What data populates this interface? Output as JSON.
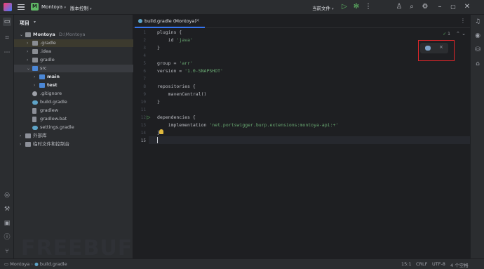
{
  "titlebar": {
    "project_badge": "M",
    "project_name": "Montoya",
    "vcs_label": "版本控制",
    "run_config": "当前文件"
  },
  "project_panel": {
    "title": "项目",
    "tree": [
      {
        "label": "Montoya",
        "path": "D:\\Montoya",
        "indent": 0,
        "expanded": true,
        "icon": "folder-icon"
      },
      {
        "label": ".gradle",
        "indent": 1,
        "expanded": false,
        "icon": "folder-icon"
      },
      {
        "label": ".idea",
        "indent": 1,
        "expanded": false,
        "icon": "folder-icon"
      },
      {
        "label": "gradle",
        "indent": 1,
        "expanded": false,
        "icon": "folder-icon"
      },
      {
        "label": "src",
        "indent": 1,
        "expanded": true,
        "icon": "folder-icon"
      },
      {
        "label": "main",
        "indent": 2,
        "expanded": false,
        "icon": "folder-icon"
      },
      {
        "label": "test",
        "indent": 2,
        "expanded": false,
        "icon": "folder-icon"
      },
      {
        "label": ".gitignore",
        "indent": 1,
        "icon": "gitignore-icon"
      },
      {
        "label": "build.gradle",
        "indent": 1,
        "icon": "gradle-icon"
      },
      {
        "label": "gradlew",
        "indent": 1,
        "icon": "file-icon"
      },
      {
        "label": "gradlew.bat",
        "indent": 1,
        "icon": "file-icon"
      },
      {
        "label": "settings.gradle",
        "indent": 1,
        "icon": "gradle-icon"
      },
      {
        "label": "外部库",
        "indent": 0,
        "expanded": false,
        "icon": "library-icon"
      },
      {
        "label": "临时文件和控制台",
        "indent": 0,
        "expanded": false,
        "icon": "scratch-icon"
      }
    ]
  },
  "editor": {
    "tab_label": "build.gradle (Montoya)",
    "inspection_count": "1",
    "line_numbers": [
      "1",
      "2",
      "3",
      "4",
      "5",
      "6",
      "7",
      "8",
      "9",
      "10",
      "11",
      "12",
      "13",
      "14",
      "15"
    ],
    "code": {
      "l1": "plugins {",
      "l2_pre": "    id ",
      "l2_str": "'java'",
      "l3": "}",
      "l5_pre": "group = ",
      "l5_str": "'arr'",
      "l6_pre": "version = ",
      "l6_str": "'1.0-SNAPSHOT'",
      "l8": "repositories {",
      "l9": "    mavenCentral()",
      "l10": "}",
      "l12": "dependencies {",
      "l13_pre": "    implementation ",
      "l13_str": "'net.portswigger.burp.extensions:montoya-api:+'",
      "l14": "}"
    }
  },
  "statusbar": {
    "crumb_project": "Montoya",
    "crumb_file": "build.gradle",
    "position": "15:1",
    "line_ending": "CRLF",
    "encoding": "UTF-8",
    "indent": "4 个空格"
  },
  "watermark": "FREEBUF"
}
